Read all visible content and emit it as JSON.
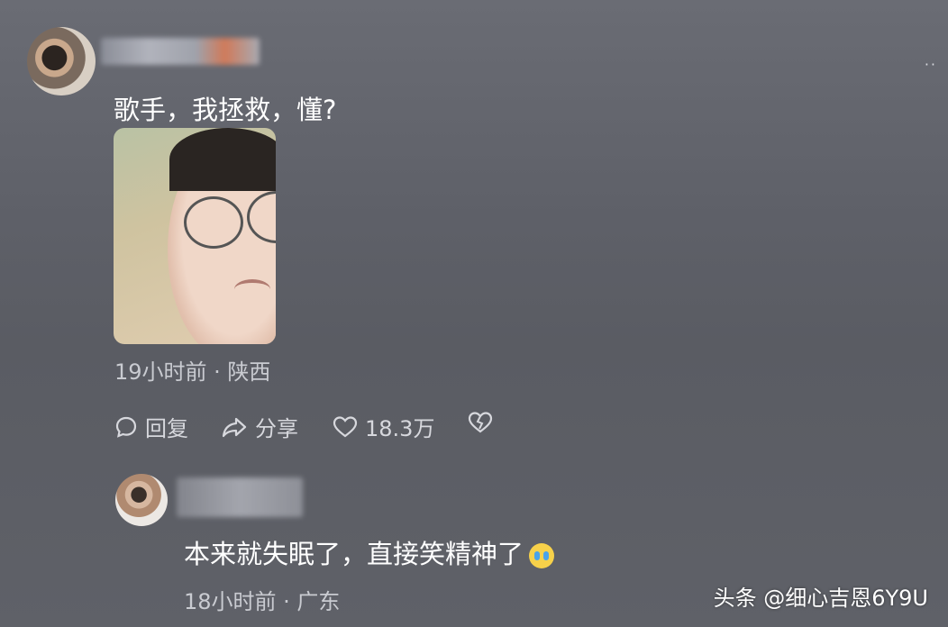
{
  "main_comment": {
    "text": "歌手，我拯救，懂?",
    "meta": "19小时前 · 陕西",
    "actions": {
      "reply": "回复",
      "share": "分享",
      "likes": "18.3万"
    }
  },
  "reply_comment": {
    "text": "本来就失眠了，直接笑精神了",
    "emoji": "loudly-crying-face",
    "meta": "18小时前 · 广东"
  },
  "watermark": "头条 @细心吉恩6Y9U",
  "colors": {
    "text": "#ffffff",
    "meta": "#c9cbd1"
  }
}
